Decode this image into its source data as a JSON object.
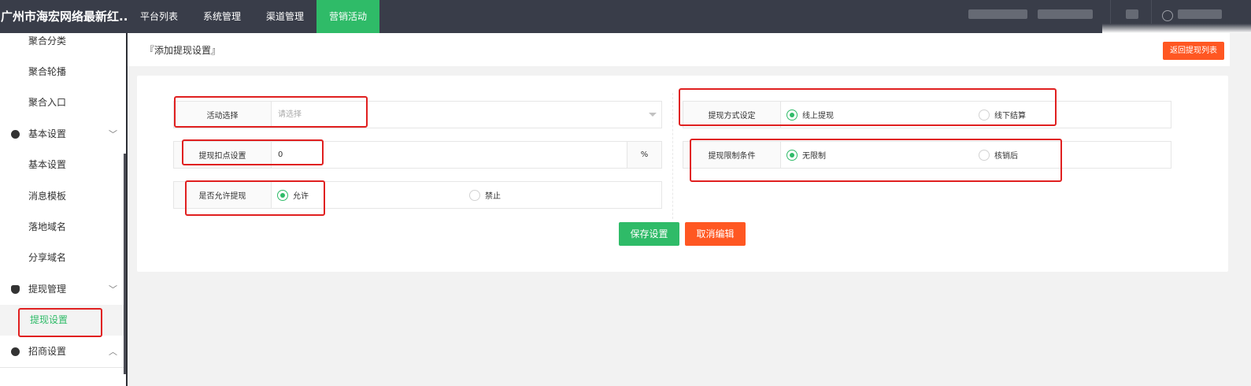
{
  "topbar": {
    "brand": "广州市海宏网络最新红...",
    "nav": [
      "平台列表",
      "系统管理",
      "渠道管理",
      "营销活动"
    ],
    "active_nav": "营销活动"
  },
  "sidebar": {
    "items": [
      {
        "label": "聚合分类",
        "kind": "sub"
      },
      {
        "label": "聚合轮播",
        "kind": "sub"
      },
      {
        "label": "聚合入口",
        "kind": "sub"
      },
      {
        "label": "基本设置",
        "kind": "group",
        "icon": "palette-icon",
        "expanded": true
      },
      {
        "label": "基本设置",
        "kind": "sub"
      },
      {
        "label": "消息模板",
        "kind": "sub"
      },
      {
        "label": "落地域名",
        "kind": "sub"
      },
      {
        "label": "分享域名",
        "kind": "sub"
      },
      {
        "label": "提现管理",
        "kind": "group",
        "icon": "money-bag-icon",
        "expanded": true
      },
      {
        "label": "提现设置",
        "kind": "sub",
        "active": true
      },
      {
        "label": "招商设置",
        "kind": "group",
        "icon": "compass-icon",
        "expanded": false
      }
    ]
  },
  "header": {
    "title": "『添加提现设置』",
    "back_button": "返回提现列表"
  },
  "form": {
    "activity": {
      "label": "活动选择",
      "placeholder": "请选择"
    },
    "deduction": {
      "label": "提现扣点设置",
      "value": "0",
      "suffix": "%"
    },
    "allow": {
      "label": "是否允许提现",
      "options": [
        "允许",
        "禁止"
      ],
      "selected": "允许"
    },
    "method": {
      "label": "提现方式设定",
      "options": [
        "线上提现",
        "线下结算"
      ],
      "selected": "线上提现"
    },
    "limit": {
      "label": "提现限制条件",
      "options": [
        "无限制",
        "核销后"
      ],
      "selected": "无限制"
    }
  },
  "actions": {
    "save": "保存设置",
    "cancel": "取消编辑"
  },
  "colors": {
    "accent": "#2fbb68",
    "danger": "#ff5722",
    "topbar": "#393d49",
    "highlight": "#e02020"
  }
}
